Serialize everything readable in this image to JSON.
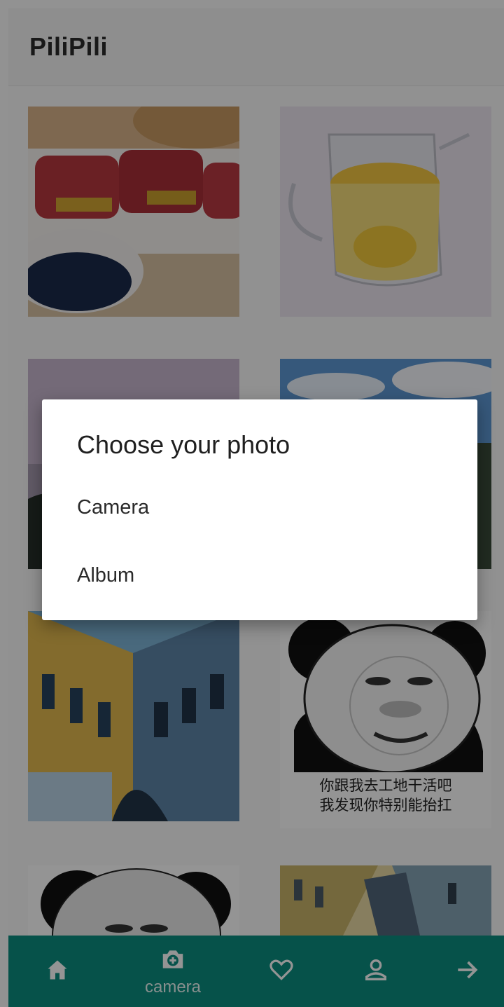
{
  "app": {
    "title": "PiliPili"
  },
  "feed": {
    "images": [
      {
        "name": "food-rolls-photo"
      },
      {
        "name": "lemon-tea-photo"
      },
      {
        "name": "sky-tower-photo"
      },
      {
        "name": "sky-clouds-photo"
      },
      {
        "name": "painted-building-photo"
      },
      {
        "name": "panda-meme-photo",
        "caption_line1": "你跟我去工地干活吧",
        "caption_line2": "我发现你特别能抬扛"
      },
      {
        "name": "panda-meme-2-photo"
      },
      {
        "name": "painted-building-2-photo"
      }
    ]
  },
  "bottom_nav": {
    "items": [
      {
        "icon": "home-icon",
        "label": ""
      },
      {
        "icon": "camera-icon",
        "label": "camera"
      },
      {
        "icon": "heart-icon",
        "label": ""
      },
      {
        "icon": "profile-icon",
        "label": ""
      },
      {
        "icon": "arrow-right-icon",
        "label": ""
      }
    ]
  },
  "dialog": {
    "title": "Choose your photo",
    "options": [
      "Camera",
      "Album"
    ]
  },
  "colors": {
    "nav_background": "#0b8e80",
    "scrim": "rgba(0,0,0,0.42)"
  }
}
